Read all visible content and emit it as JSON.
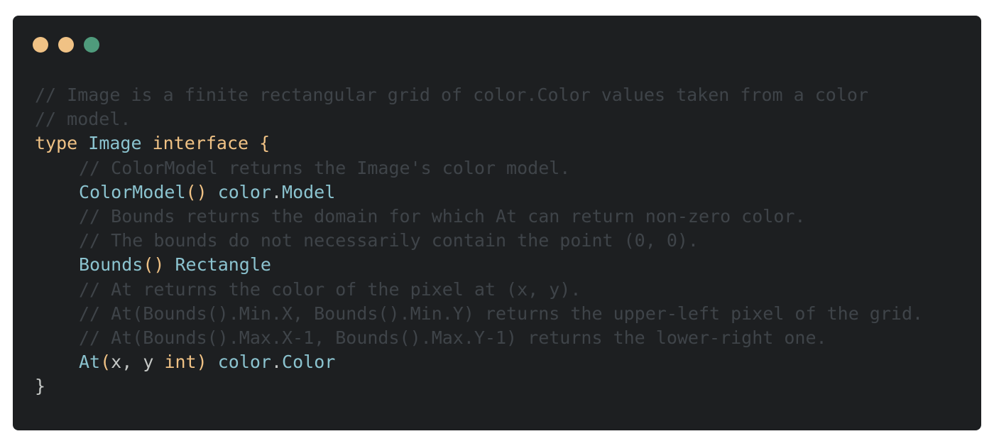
{
  "window": {
    "controls": [
      {
        "name": "close",
        "color": "#f0c285"
      },
      {
        "name": "minimize",
        "color": "#f0c285"
      },
      {
        "name": "zoom",
        "color": "#4f9b7c"
      }
    ]
  },
  "palette": {
    "comment": "#3f4449",
    "keyword": "#f0c285",
    "type": "#8bc3cf",
    "ident": "#c5c8c6",
    "package": "#8bc3cf"
  },
  "code": {
    "lines": [
      {
        "indent": 0,
        "tokens": [
          {
            "kind": "comment",
            "text": "// Image is a finite rectangular grid of color.Color values taken from a color"
          }
        ]
      },
      {
        "indent": 0,
        "tokens": [
          {
            "kind": "comment",
            "text": "// model."
          }
        ]
      },
      {
        "indent": 0,
        "tokens": [
          {
            "kind": "keyword",
            "text": "type"
          },
          {
            "kind": "plain",
            "text": " "
          },
          {
            "kind": "type",
            "text": "Image"
          },
          {
            "kind": "plain",
            "text": " "
          },
          {
            "kind": "keyword",
            "text": "interface"
          },
          {
            "kind": "plain",
            "text": " "
          },
          {
            "kind": "keyword",
            "text": "{"
          }
        ]
      },
      {
        "indent": 1,
        "tokens": [
          {
            "kind": "comment",
            "text": "// ColorModel returns the Image's color model."
          }
        ]
      },
      {
        "indent": 1,
        "tokens": [
          {
            "kind": "type",
            "text": "ColorModel"
          },
          {
            "kind": "keyword",
            "text": "()"
          },
          {
            "kind": "plain",
            "text": " "
          },
          {
            "kind": "package",
            "text": "color"
          },
          {
            "kind": "ident",
            "text": "."
          },
          {
            "kind": "type",
            "text": "Model"
          }
        ]
      },
      {
        "indent": 1,
        "tokens": [
          {
            "kind": "comment",
            "text": "// Bounds returns the domain for which At can return non-zero color."
          }
        ]
      },
      {
        "indent": 1,
        "tokens": [
          {
            "kind": "comment",
            "text": "// The bounds do not necessarily contain the point (0, 0)."
          }
        ]
      },
      {
        "indent": 1,
        "tokens": [
          {
            "kind": "type",
            "text": "Bounds"
          },
          {
            "kind": "keyword",
            "text": "()"
          },
          {
            "kind": "plain",
            "text": " "
          },
          {
            "kind": "type",
            "text": "Rectangle"
          }
        ]
      },
      {
        "indent": 1,
        "tokens": [
          {
            "kind": "comment",
            "text": "// At returns the color of the pixel at (x, y)."
          }
        ]
      },
      {
        "indent": 1,
        "tokens": [
          {
            "kind": "comment",
            "text": "// At(Bounds().Min.X, Bounds().Min.Y) returns the upper-left pixel of the grid."
          }
        ]
      },
      {
        "indent": 1,
        "tokens": [
          {
            "kind": "comment",
            "text": "// At(Bounds().Max.X-1, Bounds().Max.Y-1) returns the lower-right one."
          }
        ]
      },
      {
        "indent": 1,
        "tokens": [
          {
            "kind": "type",
            "text": "At"
          },
          {
            "kind": "keyword",
            "text": "("
          },
          {
            "kind": "ident",
            "text": "x, y "
          },
          {
            "kind": "keyword",
            "text": "int"
          },
          {
            "kind": "keyword",
            "text": ")"
          },
          {
            "kind": "plain",
            "text": " "
          },
          {
            "kind": "package",
            "text": "color"
          },
          {
            "kind": "ident",
            "text": "."
          },
          {
            "kind": "type",
            "text": "Color"
          }
        ]
      },
      {
        "indent": 0,
        "tokens": [
          {
            "kind": "ident",
            "text": "}"
          }
        ]
      }
    ]
  }
}
